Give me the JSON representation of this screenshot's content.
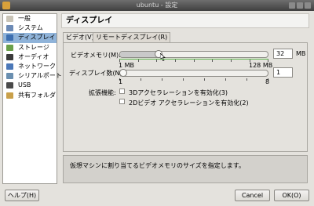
{
  "window": {
    "title": "ubuntu - 設定"
  },
  "sidebar": {
    "items": [
      {
        "label": "一般",
        "icon": "general-icon",
        "color": "#c9c4b7"
      },
      {
        "label": "システム",
        "icon": "system-icon",
        "color": "#6c8ab5"
      },
      {
        "label": "ディスプレイ",
        "icon": "display-icon",
        "color": "#3d6fb0"
      },
      {
        "label": "ストレージ",
        "icon": "storage-icon",
        "color": "#6aa04a"
      },
      {
        "label": "オーディオ",
        "icon": "audio-icon",
        "color": "#3a3a3a"
      },
      {
        "label": "ネットワーク",
        "icon": "network-icon",
        "color": "#4b78b8"
      },
      {
        "label": "シリアルポート",
        "icon": "serial-port-icon",
        "color": "#6a8fb0"
      },
      {
        "label": "USB",
        "icon": "usb-icon",
        "color": "#4a4a4a"
      },
      {
        "label": "共有フォルダ",
        "icon": "shared-folder-icon",
        "color": "#c9a04a"
      }
    ],
    "selected_index": 2
  },
  "page": {
    "title": "ディスプレイ"
  },
  "tabs": [
    {
      "label": "ビデオ(V)"
    },
    {
      "label": "リモートディスプレイ(R)"
    }
  ],
  "video": {
    "memory_label": "ビデオメモリ(M):",
    "memory_value": "32",
    "memory_unit": "MB",
    "memory_min": "1 MB",
    "memory_max": "128 MB",
    "memory_fraction": 0.25,
    "monitors_label": "ディスプレイ数(N):",
    "monitors_value": "1",
    "monitors_min": "1",
    "monitors_max": "8",
    "monitors_fraction": 0,
    "extensions_label": "拡張機能:",
    "accel3d_label": "3Dアクセラレーションを有効化(3)",
    "accel2d_label": "2Dビデオ アクセラレーションを有効化(2)"
  },
  "info": {
    "text": "仮想マシンに割り当てるビデオメモリのサイズを指定します。"
  },
  "buttons": {
    "help": "ヘルプ(H)",
    "cancel": "Cancel",
    "ok": "OK(O)"
  }
}
